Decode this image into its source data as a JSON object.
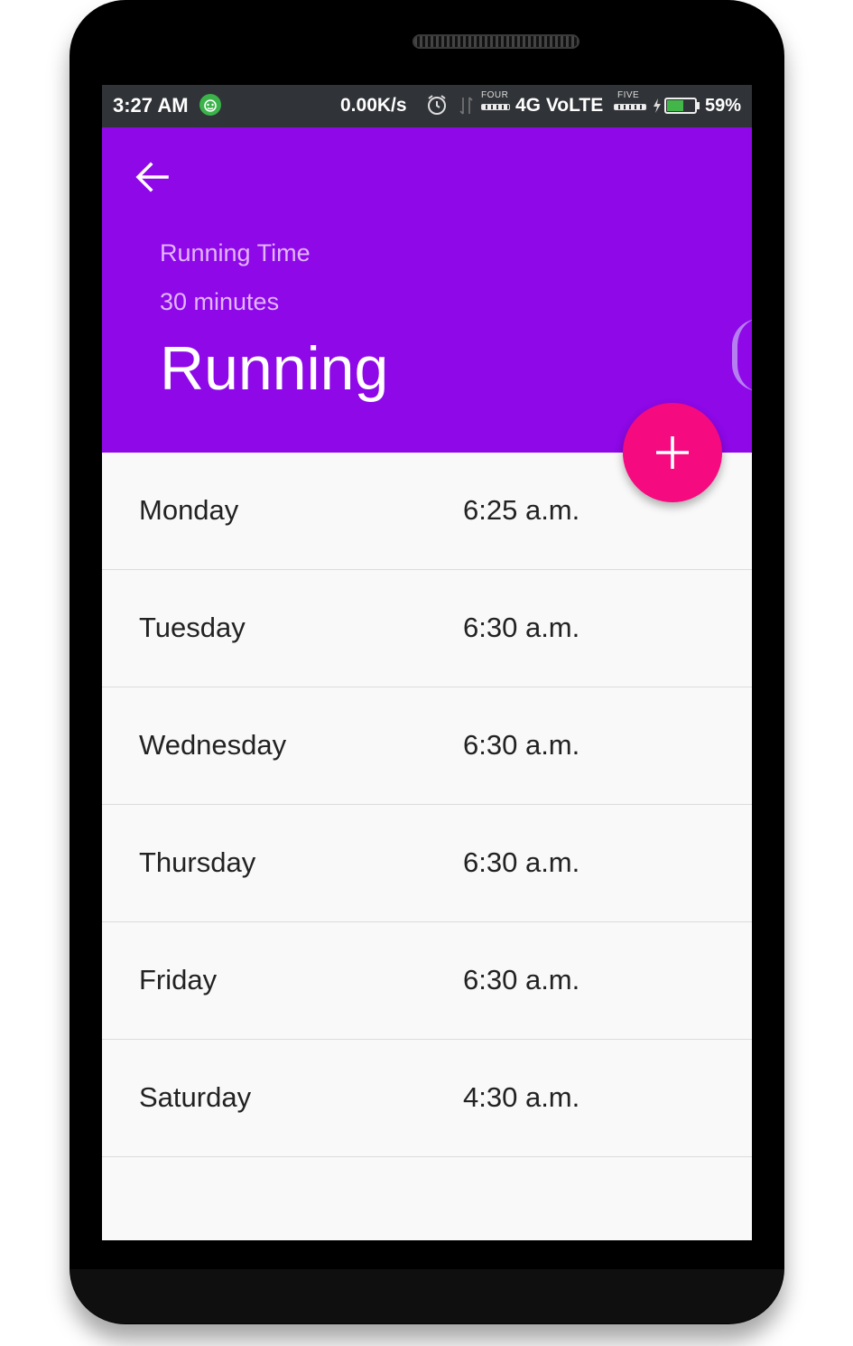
{
  "status_bar": {
    "time": "3:27 AM",
    "net_speed": "0.00K/s",
    "sim1_label": "FOUR",
    "network": "4G VoLTE",
    "sim2_label": "FIVE",
    "battery_percent": "59%",
    "battery_level": 0.59,
    "icons": [
      "app-notification-icon",
      "alarm-icon",
      "data-transfer-icon",
      "signal-icon",
      "charging-icon",
      "battery-icon"
    ]
  },
  "header": {
    "back_icon": "arrow-left-icon",
    "label": "Running Time",
    "duration": "30 minutes",
    "title": "Running",
    "background_color": "#8e08e8"
  },
  "fab": {
    "icon": "plus-icon",
    "color": "#f50a7f"
  },
  "schedule": [
    {
      "day": "Monday",
      "time": "6:25 a.m."
    },
    {
      "day": "Tuesday",
      "time": "6:30 a.m."
    },
    {
      "day": "Wednesday",
      "time": "6:30 a.m."
    },
    {
      "day": "Thursday",
      "time": "6:30 a.m."
    },
    {
      "day": "Friday",
      "time": "6:30 a.m."
    },
    {
      "day": "Saturday",
      "time": "4:30 a.m."
    }
  ]
}
